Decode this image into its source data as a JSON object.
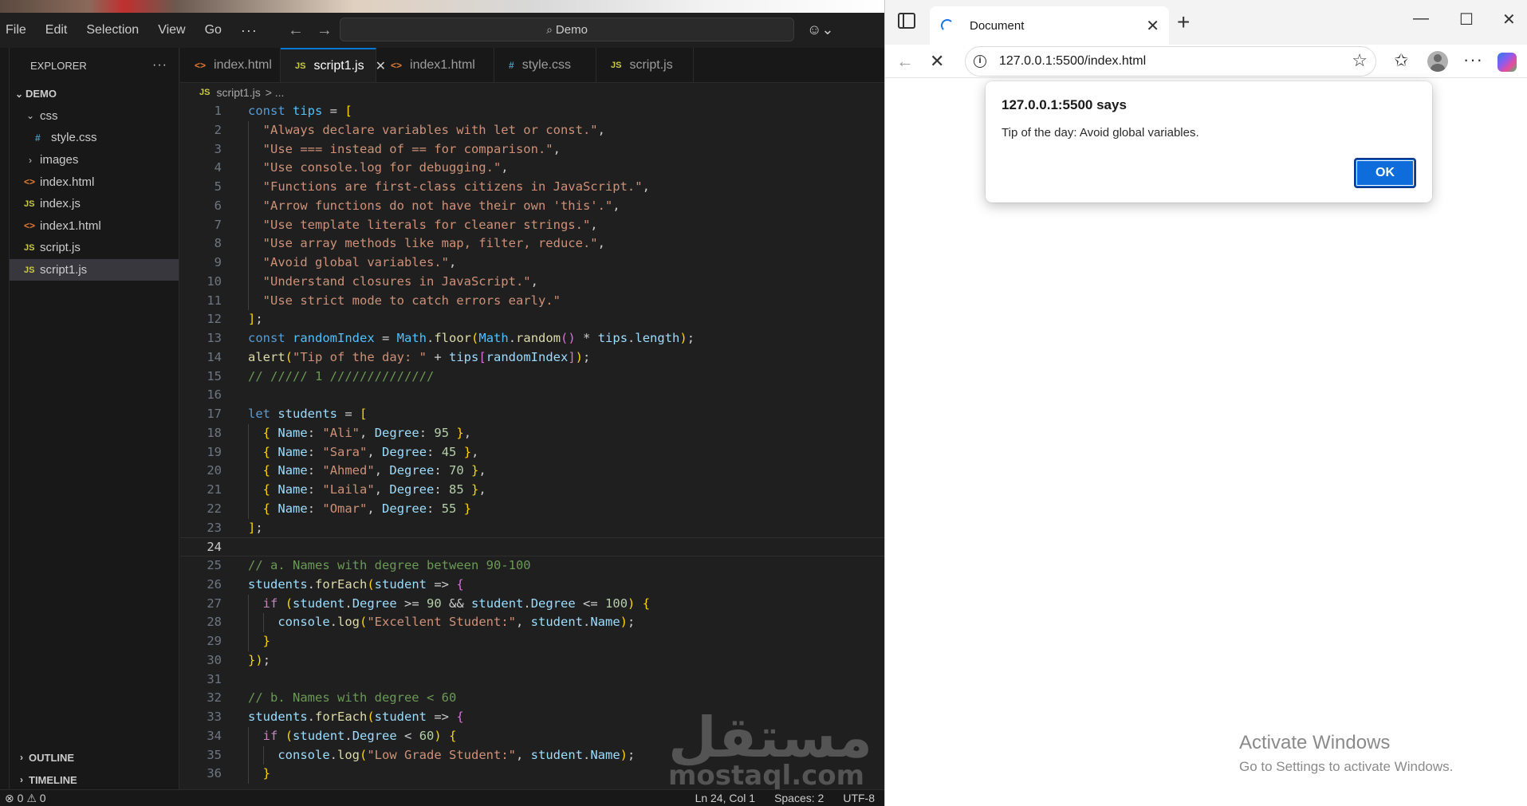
{
  "vscode": {
    "menu": [
      "File",
      "Edit",
      "Selection",
      "View",
      "Go"
    ],
    "menu_more": "···",
    "command_center": "Demo",
    "explorer": {
      "title": "EXPLORER",
      "more": "···",
      "root": "DEMO",
      "items": [
        {
          "label": "css",
          "type": "folder",
          "expanded": true,
          "depth": 1
        },
        {
          "label": "style.css",
          "type": "css",
          "depth": 2
        },
        {
          "label": "images",
          "type": "folder",
          "expanded": false,
          "depth": 1
        },
        {
          "label": "index.html",
          "type": "html",
          "depth": 1
        },
        {
          "label": "index.js",
          "type": "js",
          "depth": 1
        },
        {
          "label": "index1.html",
          "type": "html",
          "depth": 1
        },
        {
          "label": "script.js",
          "type": "js",
          "depth": 1
        },
        {
          "label": "script1.js",
          "type": "js",
          "depth": 1,
          "selected": true
        }
      ],
      "outline": "OUTLINE",
      "timeline": "TIMELINE"
    },
    "tabs": [
      {
        "label": "index.html",
        "type": "html"
      },
      {
        "label": "script1.js",
        "type": "js",
        "active": true
      },
      {
        "label": "index1.html",
        "type": "html"
      },
      {
        "label": "style.css",
        "type": "css"
      },
      {
        "label": "script.js",
        "type": "js"
      }
    ],
    "breadcrumb": {
      "file": "script1.js",
      "rest": "> ..."
    },
    "current_line": 24,
    "code_lines": [
      "const tips = [",
      "  \"Always declare variables with let or const.\",",
      "  \"Use === instead of == for comparison.\",",
      "  \"Use console.log for debugging.\",",
      "  \"Functions are first-class citizens in JavaScript.\",",
      "  \"Arrow functions do not have their own 'this'.\",",
      "  \"Use template literals for cleaner strings.\",",
      "  \"Use array methods like map, filter, reduce.\",",
      "  \"Avoid global variables.\",",
      "  \"Understand closures in JavaScript.\",",
      "  \"Use strict mode to catch errors early.\"",
      "];",
      "const randomIndex = Math.floor(Math.random() * tips.length);",
      "alert(\"Tip of the day: \" + tips[randomIndex]);",
      "// ///// 1 //////////////",
      "",
      "let students = [",
      "  { Name: \"Ali\", Degree: 95 },",
      "  { Name: \"Sara\", Degree: 45 },",
      "  { Name: \"Ahmed\", Degree: 70 },",
      "  { Name: \"Laila\", Degree: 85 },",
      "  { Name: \"Omar\", Degree: 55 }",
      "];",
      "",
      "// a. Names with degree between 90-100",
      "students.forEach(student => {",
      "  if (student.Degree >= 90 && student.Degree <= 100) {",
      "    console.log(\"Excellent Student:\", student.Name);",
      "  }",
      "});",
      "",
      "// b. Names with degree < 60",
      "students.forEach(student => {",
      "  if (student.Degree < 60) {",
      "    console.log(\"Low Grade Student:\", student.Name);",
      "  }"
    ],
    "watermark": {
      "arabic": "مستقل",
      "latin": "mostaql.com"
    },
    "status": {
      "errors": "0",
      "warnings": "0",
      "position": "Ln 24, Col 1",
      "spaces": "Spaces: 2",
      "encoding": "UTF-8"
    }
  },
  "edge": {
    "tab_title": "Document",
    "url": "127.0.0.1:5500/index.html",
    "alert": {
      "title": "127.0.0.1:5500 says",
      "message": "Tip of the day: Avoid global variables.",
      "ok_label": "OK"
    },
    "activation": {
      "line1": "Activate Windows",
      "line2": "Go to Settings to activate Windows."
    }
  },
  "colors": {
    "editor_bg": "#1f1f1f",
    "accent": "#0078d4",
    "ok_button": "#0f6cdb"
  }
}
